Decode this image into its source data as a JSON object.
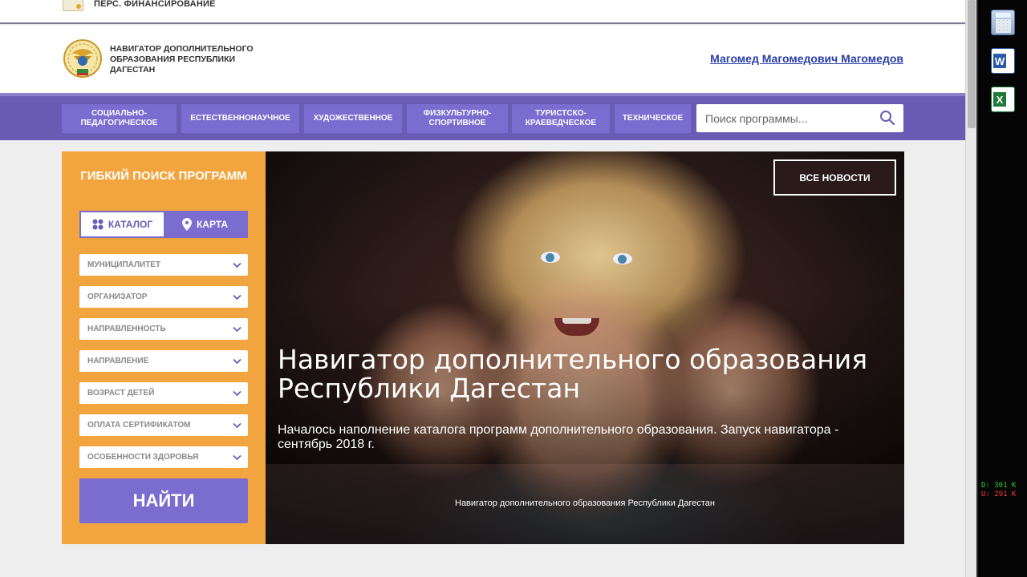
{
  "topbar": {
    "pf_label": "ПЕРС. ФИНАНСИРОВАНИЕ"
  },
  "header": {
    "site_title_lines": [
      "НАВИГАТОР ДОПОЛНИТЕЛЬНОГО",
      "ОБРАЗОВАНИЯ РЕСПУБЛИКИ",
      "ДАГЕСТАН"
    ],
    "user_name": "Магомед Магомедович Магомедов"
  },
  "nav": {
    "items": [
      "СОЦИАЛЬНО-ПЕДАГОГИЧЕСКОЕ",
      "ЕСТЕСТВЕННОНАУЧНОЕ",
      "ХУДОЖЕСТВЕННОЕ",
      "ФИЗКУЛЬТУРНО-СПОРТИВНОЕ",
      "ТУРИСТСКО-КРАЕВЕДЧЕСКОЕ",
      "ТЕХНИЧЕСКОЕ"
    ],
    "search_placeholder": "Поиск программы..."
  },
  "sidebar": {
    "title": "ГИБКИЙ ПОИСК ПРОГРАММ",
    "toggle": {
      "catalog": "КАТАЛОГ",
      "map": "КАРТА",
      "active": "catalog"
    },
    "filters": [
      "МУНИЦИПАЛИТЕТ",
      "ОРГАНИЗАТОР",
      "НАПРАВЛЕННОСТЬ",
      "НАПРАВЛЕНИЕ",
      "ВОЗРАСТ ДЕТЕЙ",
      "ОПЛАТА СЕРТИФИКАТОМ",
      "ОСОБЕННОСТИ ЗДОРОВЬЯ"
    ],
    "find_label": "НАЙТИ"
  },
  "hero": {
    "all_news": "ВСЕ НОВОСТИ",
    "title": "Навигатор дополнительного образования Республики Дагестан",
    "subtitle": "Началось наполнение каталога программ дополнительного образования. Запуск навигатора - сентябрь 2018 г.",
    "caption": "Навигатор дополнительного образования Республики Дагестан"
  },
  "dock": {
    "apps": [
      "calculator-icon",
      "word-icon",
      "excel-icon"
    ],
    "net_down": "D: 301 K",
    "net_up": "U: 291 K"
  },
  "colors": {
    "brand_purple": "#6a5cb4",
    "button_purple": "#7b6cd0",
    "sidebar_orange": "#f2a53e",
    "user_link": "#2a3ea8"
  }
}
